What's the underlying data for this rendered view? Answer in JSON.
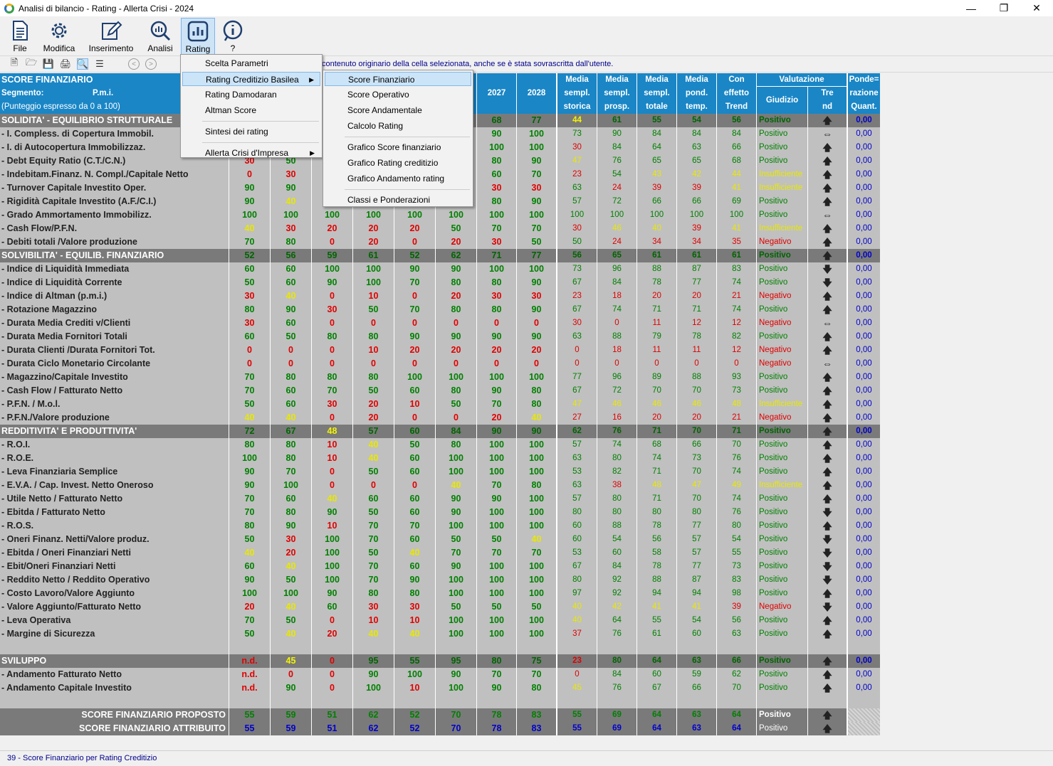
{
  "window": {
    "title": "Analisi di bilancio - Rating - Allerta Crisi - 2024"
  },
  "ribbon": [
    {
      "label": "File",
      "icon": "file-icon"
    },
    {
      "label": "Modifica",
      "icon": "gear-icon"
    },
    {
      "label": "Inserimento",
      "icon": "edit-icon"
    },
    {
      "label": "Analisi",
      "icon": "magnifier-chart-icon"
    },
    {
      "label": "Rating",
      "icon": "bar-chart-icon"
    },
    {
      "label": "?",
      "icon": "info-icon"
    }
  ],
  "toolbar": {
    "hint": "contenuto originario della cella selezionata, anche se è stata sovrascritta dall'utente."
  },
  "header": {
    "title": "SCORE FINANZIARIO",
    "segment_label": "Segmento:",
    "segment_value": "P.m.i.",
    "scale_note": "(Punteggio espresso da 0 a 100)",
    "year_cols": [
      "2027",
      "2028"
    ],
    "media_cols": [
      {
        "l1": "Media",
        "l2": "sempl.",
        "l3": "storica"
      },
      {
        "l1": "Media",
        "l2": "sempl.",
        "l3": "prosp."
      },
      {
        "l1": "Media",
        "l2": "sempl.",
        "l3": "totale"
      },
      {
        "l1": "Media",
        "l2": "pond.",
        "l3": "temp."
      },
      {
        "l1": "Con",
        "l2": "effetto",
        "l3": "Trend"
      }
    ],
    "valutazione": "Valutazione",
    "giudizio": "Giudizio",
    "trend1": "Tre",
    "trend2": "nd",
    "pond1": "Ponde=",
    "pond2": "razione",
    "pond3": "Quant."
  },
  "rows": [
    {
      "t": "sec",
      "label": "SOLIDITA' - EQUILIBRIO STRUTTURALE",
      "v": [
        "",
        "",
        "",
        "",
        "",
        "",
        "68",
        "77"
      ],
      "s": [
        "44",
        "61",
        "55",
        "54",
        "56"
      ],
      "g": "Positivo",
      "tr": "up",
      "p": "0,00"
    },
    {
      "label": "- I. Compless. di Copertura Immobil.",
      "v": [
        "",
        "",
        "",
        "",
        "",
        "",
        "90",
        "100"
      ],
      "s": [
        "73",
        "90",
        "84",
        "84",
        "84"
      ],
      "g": "Positivo",
      "tr": "lr",
      "p": "0,00"
    },
    {
      "label": "- I. di Autocopertura  Immobilizzaz.",
      "v": [
        "",
        "",
        "",
        "",
        "",
        "",
        "100",
        "100"
      ],
      "s": [
        "30",
        "84",
        "64",
        "63",
        "66"
      ],
      "g": "Positivo",
      "tr": "up",
      "p": "0,00"
    },
    {
      "label": "- Debt Equity Ratio (C.T./C.N.)",
      "v": [
        "30",
        "50",
        "",
        "",
        "",
        "",
        "80",
        "90"
      ],
      "s": [
        "47",
        "76",
        "65",
        "65",
        "68"
      ],
      "g": "Positivo",
      "tr": "up",
      "p": "0,00"
    },
    {
      "label": "- Indebitam.Finanz. N. Compl./Capitale Netto",
      "v": [
        "0",
        "30",
        "",
        "",
        "",
        "",
        "60",
        "70"
      ],
      "s": [
        "23",
        "54",
        "43",
        "42",
        "44"
      ],
      "g": "Insufficiente",
      "tr": "up",
      "p": "0,00"
    },
    {
      "label": "- Turnover Capitale Investito Oper.",
      "v": [
        "90",
        "90",
        "",
        "",
        "",
        "",
        "30",
        "30"
      ],
      "s": [
        "63",
        "24",
        "39",
        "39",
        "41"
      ],
      "g": "Insufficiente",
      "tr": "up",
      "p": "0,00"
    },
    {
      "label": "- Rigidità Capitale Investito (A.F./C.I.)",
      "v": [
        "90",
        "40",
        "",
        "",
        "",
        "",
        "80",
        "90"
      ],
      "s": [
        "57",
        "72",
        "66",
        "66",
        "69"
      ],
      "g": "Positivo",
      "tr": "up",
      "p": "0,00"
    },
    {
      "label": "- Grado Ammortamento Immobilizz.",
      "v": [
        "100",
        "100",
        "100",
        "100",
        "100",
        "100",
        "100",
        "100"
      ],
      "s": [
        "100",
        "100",
        "100",
        "100",
        "100"
      ],
      "g": "Positivo",
      "tr": "lr",
      "p": "0,00"
    },
    {
      "label": "- Cash Flow/P.F.N.",
      "v": [
        "40",
        "30",
        "20",
        "20",
        "20",
        "50",
        "70",
        "70"
      ],
      "s": [
        "30",
        "46",
        "40",
        "39",
        "41"
      ],
      "g": "Insufficiente",
      "tr": "up",
      "p": "0,00"
    },
    {
      "label": "- Debiti totali /Valore produzione",
      "v": [
        "70",
        "80",
        "0",
        "20",
        "0",
        "20",
        "30",
        "50"
      ],
      "s": [
        "50",
        "24",
        "34",
        "34",
        "35"
      ],
      "g": "Negativo",
      "tr": "up",
      "p": "0,00"
    },
    {
      "t": "sec",
      "label": "SOLVIBILITA' - EQUILIB. FINANZIARIO",
      "v": [
        "52",
        "56",
        "59",
        "61",
        "52",
        "62",
        "71",
        "77"
      ],
      "s": [
        "56",
        "65",
        "61",
        "61",
        "61"
      ],
      "g": "Positivo",
      "tr": "up",
      "p": "0,00"
    },
    {
      "label": "- Indice di Liquidità Immediata",
      "v": [
        "60",
        "60",
        "100",
        "100",
        "90",
        "90",
        "100",
        "100"
      ],
      "s": [
        "73",
        "96",
        "88",
        "87",
        "83"
      ],
      "g": "Positivo",
      "tr": "down",
      "p": "0,00"
    },
    {
      "label": "- Indice di Liquidità Corrente",
      "v": [
        "50",
        "60",
        "90",
        "100",
        "70",
        "80",
        "80",
        "90"
      ],
      "s": [
        "67",
        "84",
        "78",
        "77",
        "74"
      ],
      "g": "Positivo",
      "tr": "down",
      "p": "0,00"
    },
    {
      "label": "- Indice di Altman (p.m.i.)",
      "v": [
        "30",
        "40",
        "0",
        "10",
        "0",
        "20",
        "30",
        "30"
      ],
      "s": [
        "23",
        "18",
        "20",
        "20",
        "21"
      ],
      "g": "Negativo",
      "tr": "up",
      "p": "0,00"
    },
    {
      "label": "- Rotazione Magazzino",
      "v": [
        "80",
        "90",
        "30",
        "50",
        "70",
        "80",
        "80",
        "90"
      ],
      "s": [
        "67",
        "74",
        "71",
        "71",
        "74"
      ],
      "g": "Positivo",
      "tr": "up",
      "p": "0,00"
    },
    {
      "label": "- Durata Media Crediti v/Clienti",
      "v": [
        "30",
        "60",
        "0",
        "0",
        "0",
        "0",
        "0",
        "0"
      ],
      "s": [
        "30",
        "0",
        "11",
        "12",
        "12"
      ],
      "g": "Negativo",
      "tr": "lr",
      "p": "0,00"
    },
    {
      "label": "- Durata Media Fornitori Totali",
      "v": [
        "60",
        "50",
        "80",
        "80",
        "90",
        "90",
        "90",
        "90"
      ],
      "s": [
        "63",
        "88",
        "79",
        "78",
        "82"
      ],
      "g": "Positivo",
      "tr": "up",
      "p": "0,00"
    },
    {
      "label": "- Durata Clienti /Durata Fornitori Tot.",
      "v": [
        "0",
        "0",
        "0",
        "10",
        "20",
        "20",
        "20",
        "20"
      ],
      "s": [
        "0",
        "18",
        "11",
        "11",
        "12"
      ],
      "g": "Negativo",
      "tr": "up",
      "p": "0,00"
    },
    {
      "label": "- Durata Ciclo Monetario Circolante",
      "v": [
        "0",
        "0",
        "0",
        "0",
        "0",
        "0",
        "0",
        "0"
      ],
      "s": [
        "0",
        "0",
        "0",
        "0",
        "0"
      ],
      "g": "Negativo",
      "tr": "lr",
      "p": "0,00"
    },
    {
      "label": "- Magazzino/Capitale Investito",
      "v": [
        "70",
        "80",
        "80",
        "80",
        "100",
        "100",
        "100",
        "100"
      ],
      "s": [
        "77",
        "96",
        "89",
        "88",
        "93"
      ],
      "g": "Positivo",
      "tr": "up",
      "p": "0,00"
    },
    {
      "label": "- Cash Flow / Fatturato Netto",
      "v": [
        "70",
        "60",
        "70",
        "50",
        "60",
        "80",
        "90",
        "80"
      ],
      "s": [
        "67",
        "72",
        "70",
        "70",
        "73"
      ],
      "g": "Positivo",
      "tr": "up",
      "p": "0,00"
    },
    {
      "label": "- P.F.N. / M.o.l.",
      "v": [
        "50",
        "60",
        "30",
        "20",
        "10",
        "50",
        "70",
        "80"
      ],
      "s": [
        "47",
        "46",
        "46",
        "46",
        "48"
      ],
      "g": "Insufficiente",
      "tr": "up",
      "p": "0,00"
    },
    {
      "label": "- P.F.N./Valore produzione",
      "v": [
        "40",
        "40",
        "0",
        "20",
        "0",
        "0",
        "20",
        "40"
      ],
      "s": [
        "27",
        "16",
        "20",
        "20",
        "21"
      ],
      "g": "Negativo",
      "tr": "up",
      "p": "0,00"
    },
    {
      "t": "sec",
      "label": "REDDITIVITA' E PRODUTTIVITA'",
      "v": [
        "72",
        "67",
        "48",
        "57",
        "60",
        "84",
        "90",
        "90"
      ],
      "s": [
        "62",
        "76",
        "71",
        "70",
        "71"
      ],
      "g": "Positivo",
      "tr": "up",
      "p": "0,00"
    },
    {
      "label": "- R.O.I.",
      "v": [
        "80",
        "80",
        "10",
        "40",
        "50",
        "80",
        "100",
        "100"
      ],
      "s": [
        "57",
        "74",
        "68",
        "66",
        "70"
      ],
      "g": "Positivo",
      "tr": "up",
      "p": "0,00"
    },
    {
      "label": "- R.O.E.",
      "v": [
        "100",
        "80",
        "10",
        "40",
        "60",
        "100",
        "100",
        "100"
      ],
      "s": [
        "63",
        "80",
        "74",
        "73",
        "76"
      ],
      "g": "Positivo",
      "tr": "up",
      "p": "0,00"
    },
    {
      "label": "- Leva Finanziaria Semplice",
      "v": [
        "90",
        "70",
        "0",
        "50",
        "60",
        "100",
        "100",
        "100"
      ],
      "s": [
        "53",
        "82",
        "71",
        "70",
        "74"
      ],
      "g": "Positivo",
      "tr": "up",
      "p": "0,00"
    },
    {
      "label": "- E.V.A. / Cap. Invest. Netto Oneroso",
      "v": [
        "90",
        "100",
        "0",
        "0",
        "0",
        "40",
        "70",
        "80"
      ],
      "s": [
        "63",
        "38",
        "48",
        "47",
        "49"
      ],
      "g": "Insufficiente",
      "tr": "up",
      "p": "0,00"
    },
    {
      "label": "- Utile Netto / Fatturato Netto",
      "v": [
        "70",
        "60",
        "40",
        "60",
        "60",
        "90",
        "90",
        "100"
      ],
      "s": [
        "57",
        "80",
        "71",
        "70",
        "74"
      ],
      "g": "Positivo",
      "tr": "up",
      "p": "0,00"
    },
    {
      "label": "- Ebitda / Fatturato Netto",
      "v": [
        "70",
        "80",
        "90",
        "50",
        "60",
        "90",
        "100",
        "100"
      ],
      "s": [
        "80",
        "80",
        "80",
        "80",
        "76"
      ],
      "g": "Positivo",
      "tr": "down",
      "p": "0,00"
    },
    {
      "label": "- R.O.S.",
      "v": [
        "80",
        "90",
        "10",
        "70",
        "70",
        "100",
        "100",
        "100"
      ],
      "s": [
        "60",
        "88",
        "78",
        "77",
        "80"
      ],
      "g": "Positivo",
      "tr": "up",
      "p": "0,00"
    },
    {
      "label": "- Oneri Finanz. Netti/Valore produz.",
      "v": [
        "50",
        "30",
        "100",
        "70",
        "60",
        "50",
        "50",
        "40"
      ],
      "s": [
        "60",
        "54",
        "56",
        "57",
        "54"
      ],
      "g": "Positivo",
      "tr": "down",
      "p": "0,00"
    },
    {
      "label": "- Ebitda / Oneri Finanziari Netti",
      "v": [
        "40",
        "20",
        "100",
        "50",
        "40",
        "70",
        "70",
        "70"
      ],
      "s": [
        "53",
        "60",
        "58",
        "57",
        "55"
      ],
      "g": "Positivo",
      "tr": "down",
      "p": "0,00"
    },
    {
      "label": "- Ebit/Oneri Finanziari Netti",
      "v": [
        "60",
        "40",
        "100",
        "70",
        "60",
        "90",
        "100",
        "100"
      ],
      "s": [
        "67",
        "84",
        "78",
        "77",
        "73"
      ],
      "g": "Positivo",
      "tr": "down",
      "p": "0,00"
    },
    {
      "label": "- Reddito Netto / Reddito Operativo",
      "v": [
        "90",
        "50",
        "100",
        "70",
        "90",
        "100",
        "100",
        "100"
      ],
      "s": [
        "80",
        "92",
        "88",
        "87",
        "83"
      ],
      "g": "Positivo",
      "tr": "down",
      "p": "0,00"
    },
    {
      "label": "- Costo Lavoro/Valore Aggiunto",
      "v": [
        "100",
        "100",
        "90",
        "80",
        "80",
        "100",
        "100",
        "100"
      ],
      "s": [
        "97",
        "92",
        "94",
        "94",
        "98"
      ],
      "g": "Positivo",
      "tr": "up",
      "p": "0,00"
    },
    {
      "label": "- Valore Aggiunto/Fatturato Netto",
      "v": [
        "20",
        "40",
        "60",
        "30",
        "30",
        "50",
        "50",
        "50"
      ],
      "s": [
        "40",
        "42",
        "41",
        "41",
        "39"
      ],
      "g": "Negativo",
      "tr": "down",
      "p": "0,00"
    },
    {
      "label": "- Leva Operativa",
      "v": [
        "70",
        "50",
        "0",
        "10",
        "10",
        "100",
        "100",
        "100"
      ],
      "s": [
        "40",
        "64",
        "55",
        "54",
        "56"
      ],
      "g": "Positivo",
      "tr": "up",
      "p": "0,00"
    },
    {
      "label": "- Margine di Sicurezza",
      "v": [
        "50",
        "40",
        "20",
        "40",
        "40",
        "100",
        "100",
        "100"
      ],
      "s": [
        "37",
        "76",
        "61",
        "60",
        "63"
      ],
      "g": "Positivo",
      "tr": "up",
      "p": "0,00"
    },
    {
      "t": "blank",
      "label": "",
      "v": [
        "",
        "",
        "",
        "",
        "",
        "",
        "",
        ""
      ],
      "s": [
        "",
        "",
        "",
        "",
        ""
      ],
      "g": "",
      "tr": "",
      "p": ""
    },
    {
      "t": "sec",
      "label": "SVILUPPO",
      "v": [
        "n.d.",
        "45",
        "0",
        "95",
        "55",
        "95",
        "80",
        "75"
      ],
      "s": [
        "23",
        "80",
        "64",
        "63",
        "66"
      ],
      "g": "Positivo",
      "tr": "up",
      "p": "0,00"
    },
    {
      "label": "- Andamento Fatturato Netto",
      "v": [
        "n.d.",
        "0",
        "0",
        "90",
        "100",
        "90",
        "70",
        "70"
      ],
      "s": [
        "0",
        "84",
        "60",
        "59",
        "62"
      ],
      "g": "Positivo",
      "tr": "up",
      "p": "0,00"
    },
    {
      "label": "- Andamento Capitale Investito",
      "v": [
        "n.d.",
        "90",
        "0",
        "100",
        "10",
        "100",
        "90",
        "80"
      ],
      "s": [
        "45",
        "76",
        "67",
        "66",
        "70"
      ],
      "g": "Positivo",
      "tr": "up",
      "p": "0,00"
    },
    {
      "t": "blank",
      "label": "",
      "v": [
        "",
        "",
        "",
        "",
        "",
        "",
        "",
        ""
      ],
      "s": [
        "",
        "",
        "",
        "",
        ""
      ],
      "g": "",
      "tr": "",
      "p": ""
    },
    {
      "t": "foot",
      "label": "SCORE FINANZIARIO PROPOSTO",
      "v": [
        "55",
        "59",
        "51",
        "62",
        "52",
        "70",
        "78",
        "83"
      ],
      "s": [
        "55",
        "69",
        "64",
        "63",
        "64"
      ],
      "g": "Positivo",
      "tr": "up",
      "p": ""
    },
    {
      "t": "foot2",
      "label": "SCORE  FINANZIARIO ATTRIBUITO",
      "v": [
        "55",
        "59",
        "51",
        "62",
        "52",
        "70",
        "78",
        "83"
      ],
      "s": [
        "55",
        "69",
        "64",
        "63",
        "64"
      ],
      "g": "Positivo",
      "tr": "up",
      "p": ""
    }
  ],
  "menu_rating": {
    "items": [
      {
        "label": "Scelta Parametri"
      },
      {
        "label": "Rating Creditizio Basilea",
        "sub": true
      },
      {
        "label": "Rating Damodaran"
      },
      {
        "label": "Altman Score"
      },
      {
        "sep": true
      },
      {
        "label": "Sintesi dei rating"
      },
      {
        "sep": true
      },
      {
        "label": "Allerta Crisi d'Impresa",
        "sub": true
      }
    ]
  },
  "menu_basilea": {
    "items": [
      {
        "label": "Score Finanziario"
      },
      {
        "label": "Score Operativo"
      },
      {
        "label": "Score Andamentale"
      },
      {
        "label": "Calcolo Rating"
      },
      {
        "sep": true
      },
      {
        "label": "Grafico Score finanziario"
      },
      {
        "label": "Grafico Rating creditizio"
      },
      {
        "label": "Grafico Andamento rating"
      },
      {
        "sep": true
      },
      {
        "label": "Classi e Ponderazioni"
      }
    ]
  },
  "status": {
    "text": "39 - Score Finanziario per Rating Creditizio"
  },
  "colors": {
    "accent": "#1a86c6",
    "positive": "#008000",
    "negative": "#e00000",
    "insufficient": "#e8e800"
  }
}
